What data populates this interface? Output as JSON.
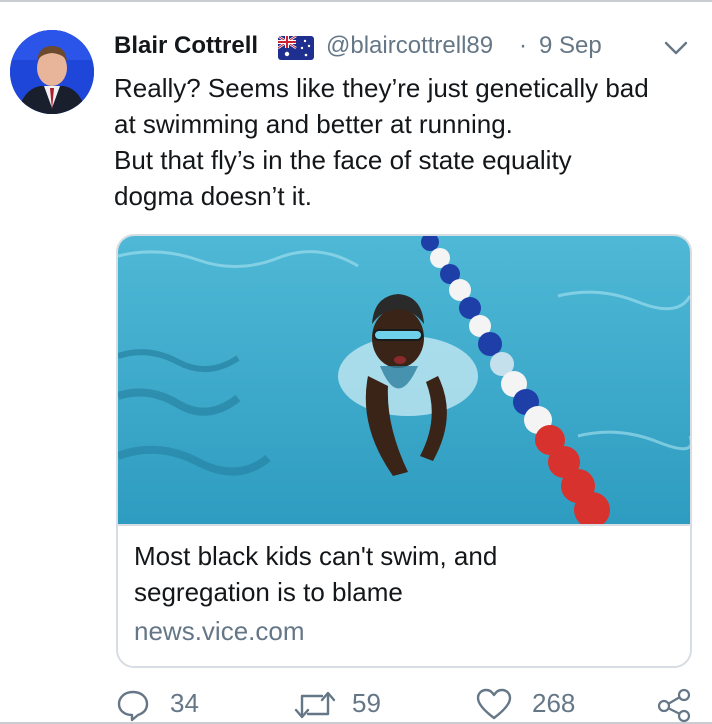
{
  "tweet": {
    "author_name": "Blair Cottrell",
    "handle": "@blaircottrell89",
    "separator": "·",
    "date": "9 Sep",
    "text_lines": [
      "Really? Seems like they’re just genetically bad",
      "at swimming and better at running.",
      "But that fly’s in the face of state equality",
      "dogma doesn’t it."
    ]
  },
  "card": {
    "title_lines": [
      "Most black kids can't swim, and",
      "segregation is to blame"
    ],
    "domain": "news.vice.com"
  },
  "actions": {
    "replies": "34",
    "retweets": "59",
    "likes": "268"
  },
  "icons": {
    "reply": "reply-icon",
    "retweet": "retweet-icon",
    "like": "heart-icon",
    "share": "share-icon",
    "more": "chevron-down-icon",
    "flag": "australia-flag-icon"
  },
  "colors": {
    "text": "#14171a",
    "muted": "#657786",
    "border": "#d7dde2"
  }
}
